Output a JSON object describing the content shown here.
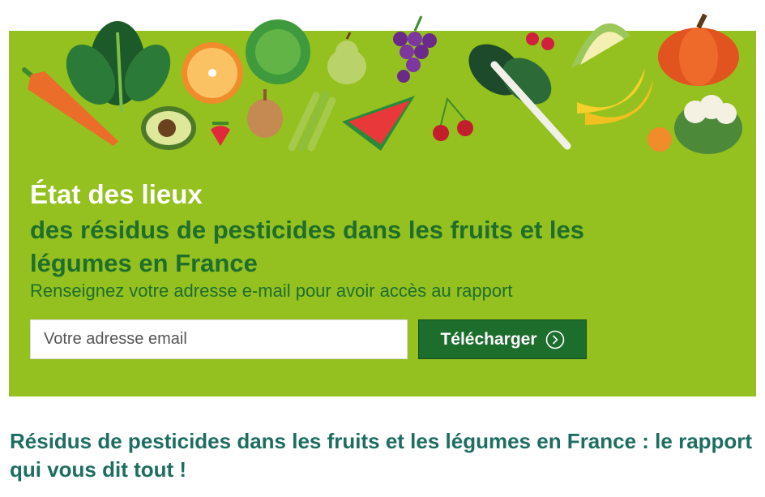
{
  "banner": {
    "title": "État des lieux",
    "subtitle": "des résidus de pesticides dans les fruits et les légumes en France",
    "hint": "Renseignez votre adresse e-mail pour avoir accès au rapport",
    "email_placeholder": "Votre adresse email",
    "email_value": "",
    "button_label": "Télécharger",
    "button_icon": "arrow-circle-right-icon",
    "accent_color": "#94c11f",
    "button_color": "#1d6d2d"
  },
  "illustrations": [
    "carrot",
    "spinach",
    "orange",
    "avocado",
    "strawberry",
    "cabbage",
    "onion",
    "pear",
    "asparagus",
    "grapes",
    "watermelon",
    "cherries",
    "chard",
    "raspberries",
    "melon",
    "banana",
    "tangerine",
    "pumpkin",
    "cauliflower"
  ],
  "article": {
    "heading": "Résidus de pesticides dans les fruits et les légumes en France : le rapport qui vous dit tout !",
    "heading_color": "#1e6d62"
  }
}
